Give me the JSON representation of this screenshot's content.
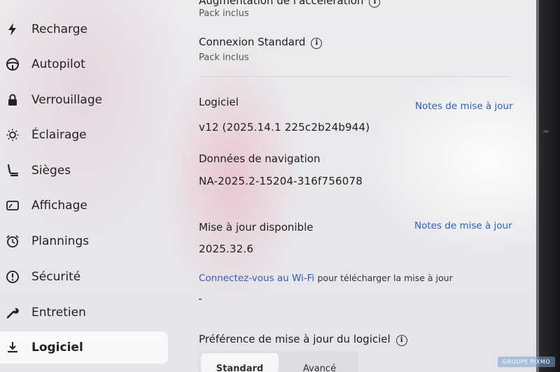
{
  "sidebar": {
    "items": [
      {
        "label": "Recharge",
        "icon": "lightning-bolt-icon"
      },
      {
        "label": "Autopilot",
        "icon": "steering-wheel-icon"
      },
      {
        "label": "Verrouillage",
        "icon": "lock-icon"
      },
      {
        "label": "Éclairage",
        "icon": "light-bulb-icon"
      },
      {
        "label": "Sièges",
        "icon": "seat-icon"
      },
      {
        "label": "Affichage",
        "icon": "display-icon"
      },
      {
        "label": "Plannings",
        "icon": "alarm-clock-icon"
      },
      {
        "label": "Sécurité",
        "icon": "alert-circle-icon"
      },
      {
        "label": "Entretien",
        "icon": "wrench-icon"
      },
      {
        "label": "Logiciel",
        "icon": "download-icon"
      }
    ],
    "active": "Logiciel"
  },
  "main": {
    "acceleration": {
      "title": "Augmentation de l'accélération",
      "sub": "Pack inclus"
    },
    "connexion": {
      "title": "Connexion Standard",
      "sub": "Pack inclus"
    },
    "logiciel": {
      "title": "Logiciel",
      "value": "v12 (2025.14.1 225c2b24b944)",
      "link": "Notes de mise à jour"
    },
    "navigation": {
      "title": "Données de navigation",
      "value": "NA-2025.2-15204-316f756078"
    },
    "update": {
      "title": "Mise à jour disponible",
      "value": "2025.32.6",
      "link": "Notes de mise à jour",
      "wifi_link": "Connectez-vous au Wi-Fi",
      "wifi_text": "pour télécharger la mise à jour",
      "progress": 0.01
    },
    "preference": {
      "title": "Préférence de mise à jour du logiciel",
      "options": [
        "Standard",
        "Avancé"
      ],
      "selected": "Standard"
    }
  },
  "watermark": "GROUPE PIXMO",
  "colors": {
    "link": "#2d61b3",
    "progress": "#22a34a",
    "active_bg": "#ffffff"
  }
}
